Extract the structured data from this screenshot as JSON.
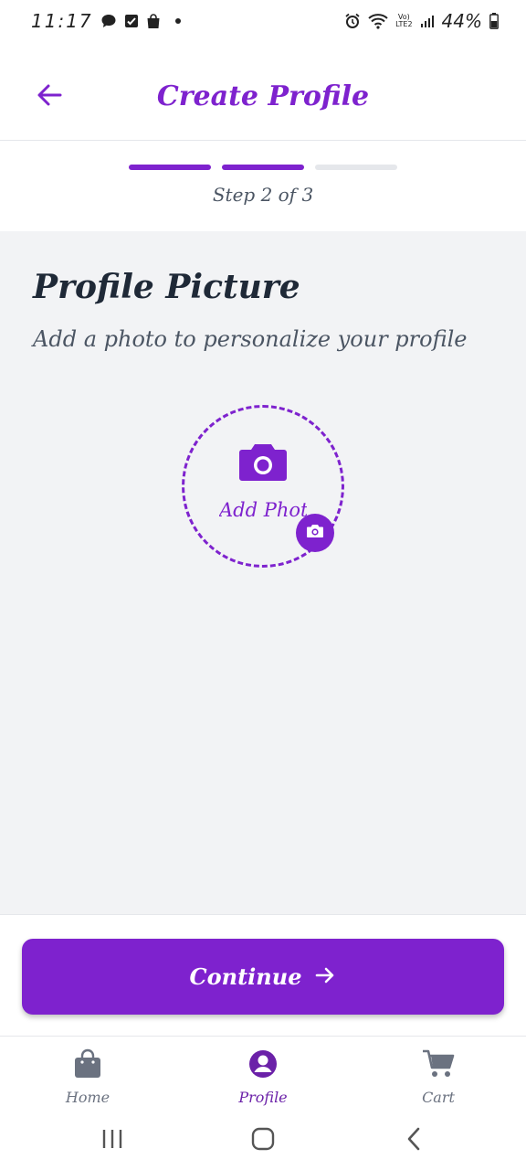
{
  "status_bar": {
    "time": "11:17",
    "battery": "44%",
    "network": "LTE2",
    "icons": [
      "chat-icon",
      "check-square-icon",
      "bag-icon",
      "dot-icon",
      "alarm-icon",
      "wifi-icon",
      "signal-icon",
      "battery-icon"
    ]
  },
  "header": {
    "title": "Create Profile",
    "back_icon": "arrow-left-icon"
  },
  "progress": {
    "step_text": "Step 2 of 3",
    "current_step": 2,
    "total_steps": 3
  },
  "profile_picture": {
    "title": "Profile Picture",
    "subtitle": "Add a photo to personalize your profile",
    "add_photo_label": "Add Photo",
    "camera_icon": "camera-icon"
  },
  "continue_button": {
    "label": "Continue",
    "icon": "arrow-right-icon"
  },
  "bottom_nav": {
    "items": [
      {
        "label": "Home",
        "icon": "shopping-bag-icon",
        "active": false
      },
      {
        "label": "Profile",
        "icon": "user-circle-icon",
        "active": true
      },
      {
        "label": "Cart",
        "icon": "cart-icon",
        "active": false
      }
    ]
  },
  "colors": {
    "accent": "#7e22ce",
    "background": "#f2f3f5",
    "inactive": "#6b7280",
    "bar_inactive": "#e5e7eb"
  }
}
